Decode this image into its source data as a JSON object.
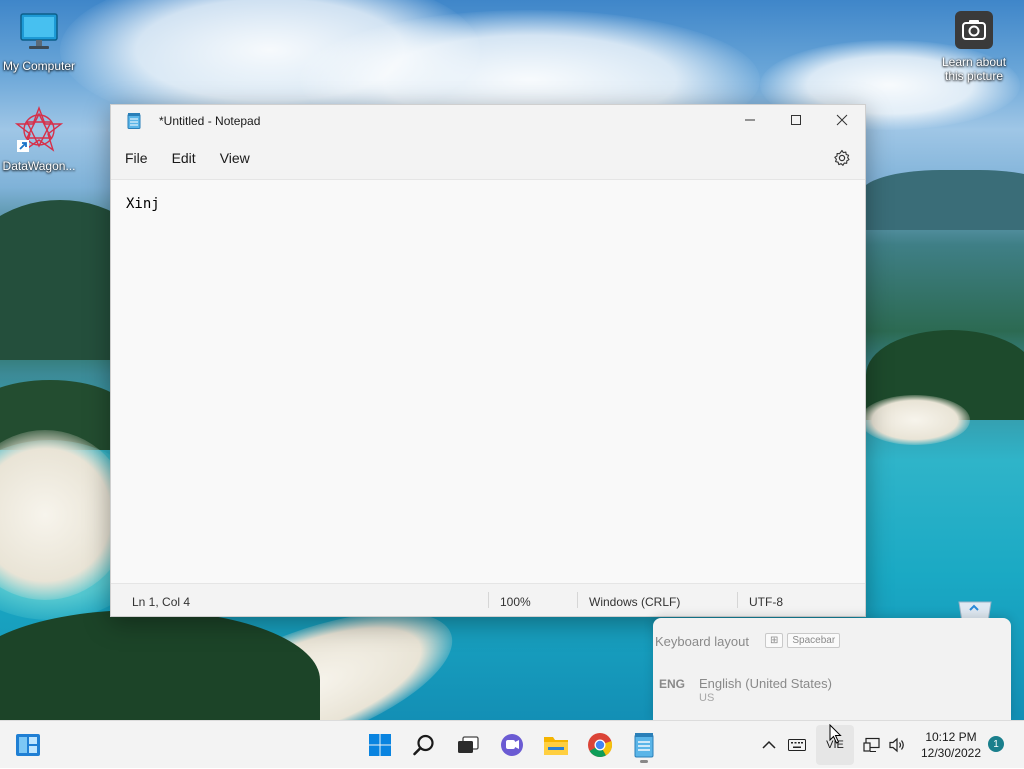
{
  "desktop": {
    "icons": [
      {
        "label": "My Computer"
      },
      {
        "label": "DataWagon..."
      },
      {
        "label": "Learn about this picture"
      }
    ]
  },
  "notepad": {
    "title": "*Untitled - Notepad",
    "menu": [
      "File",
      "Edit",
      "View"
    ],
    "content": "Xinj",
    "status": {
      "position": "Ln 1, Col 4",
      "zoom": "100%",
      "line_ending": "Windows (CRLF)",
      "encoding": "UTF-8"
    }
  },
  "language_flyout": {
    "heading": "Keyboard layout",
    "shortcut": "Spacebar",
    "code": "ENG",
    "language": "English (United States)",
    "layout": "US"
  },
  "taskbar": {
    "apps": [
      "widgets-icon",
      "start-icon",
      "search-icon",
      "task-view-icon",
      "chat-icon",
      "file-explorer-icon",
      "chrome-icon",
      "notepad-icon"
    ],
    "ime_indicator": "VIE",
    "time": "10:12 PM",
    "date": "12/30/2022",
    "notification_count": "1"
  },
  "colors": {
    "accent": "#0067c0",
    "taskbar_bg": "#f3f3f3",
    "badge": "#1a7f8c"
  }
}
